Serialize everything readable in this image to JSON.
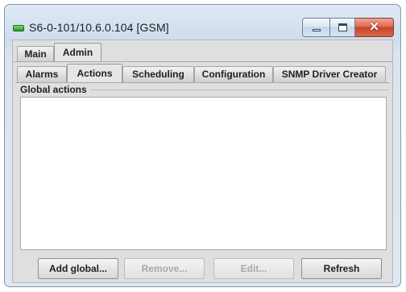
{
  "window": {
    "title": "S6-0-101/10.6.0.104 [GSM]",
    "close_symbol": "✕"
  },
  "tabs": {
    "main": "Main",
    "admin": "Admin"
  },
  "subtabs": {
    "alarms": "Alarms",
    "actions": "Actions",
    "scheduling": "Scheduling",
    "configuration": "Configuration",
    "snmp": "SNMP Driver Creator"
  },
  "global_actions": {
    "label": "Global actions",
    "items": []
  },
  "buttons": {
    "add": "Add global...",
    "remove": "Remove...",
    "edit": "Edit...",
    "refresh": "Refresh"
  },
  "icons": {
    "app": "status-led-icon",
    "minimize": "minimize-icon",
    "maximize": "maximize-icon",
    "close": "close-icon"
  },
  "colors": {
    "status_led": "#2fbf2f",
    "close_button": "#d0553a"
  }
}
